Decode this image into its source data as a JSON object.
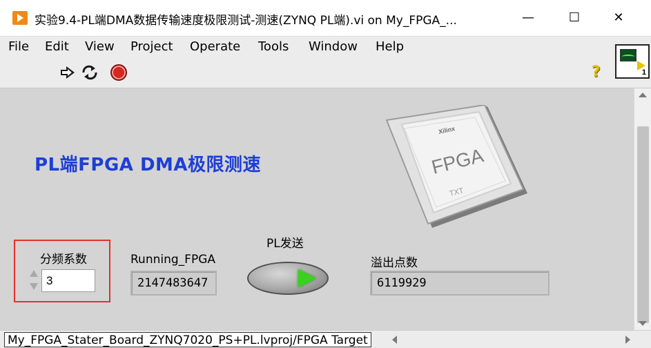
{
  "window": {
    "title": "实验9.4-PL端DMA数据传输速度极限测试-测速(ZYNQ PL端).vi on My_FPGA_...",
    "minimize": "—",
    "maximize": "☐",
    "close": "✕"
  },
  "menu": {
    "items": [
      "File",
      "Edit",
      "View",
      "Project",
      "Operate",
      "Tools",
      "Window",
      "Help"
    ]
  },
  "vi_icon": {
    "number": "1"
  },
  "toolbar": {
    "help": "?"
  },
  "panel": {
    "heading": "PL端FPGA DMA极限测速",
    "chip": {
      "brand": "Xilinx",
      "label": "FPGA",
      "sub": "TXT"
    },
    "divider_control": {
      "label": "分频系数",
      "value": "3"
    },
    "running_fpga": {
      "label": "Running_FPGA",
      "value": "2147483647"
    },
    "pl_send": {
      "label": "PL发送"
    },
    "overflow": {
      "label": "溢出点数",
      "value": "6119929"
    }
  },
  "status": {
    "path": "My_FPGA_Stater_Board_ZYNQ7020_PS+PL.lvproj/FPGA Target"
  },
  "colors": {
    "heading": "#1d3fd6",
    "highlight": "#e4312b",
    "pl_led": "#38d21f",
    "panel_bg": "#d4d4d4",
    "app_icon": "#f08a17"
  }
}
